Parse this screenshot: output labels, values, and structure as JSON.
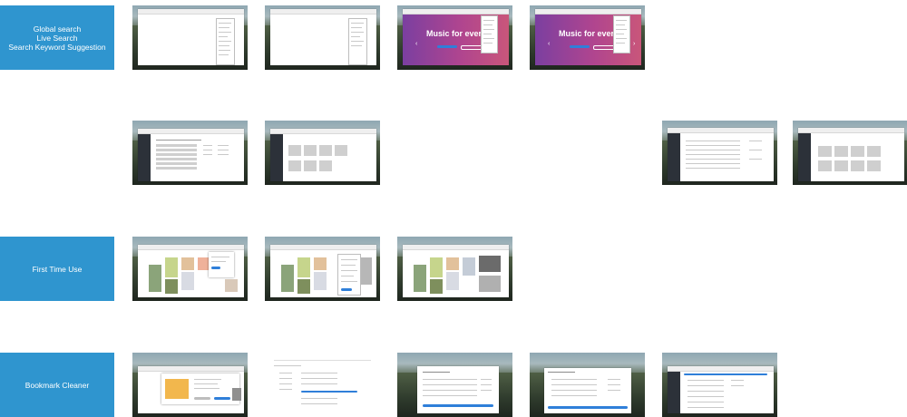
{
  "rows": [
    {
      "label_lines": [
        "Global search",
        "Live Search",
        "Search Keyword Suggestion"
      ]
    },
    {
      "label_lines": []
    },
    {
      "label_lines": [
        "First Time Use"
      ]
    },
    {
      "label_lines": [
        "Bookmark Cleaner"
      ]
    }
  ],
  "promo": {
    "headline": "Music for everyo"
  },
  "colors": {
    "label_bg": "#2f95cf",
    "accent": "#2f7fd9",
    "promo_start": "#7b3fa0",
    "promo_end": "#c9567a"
  }
}
